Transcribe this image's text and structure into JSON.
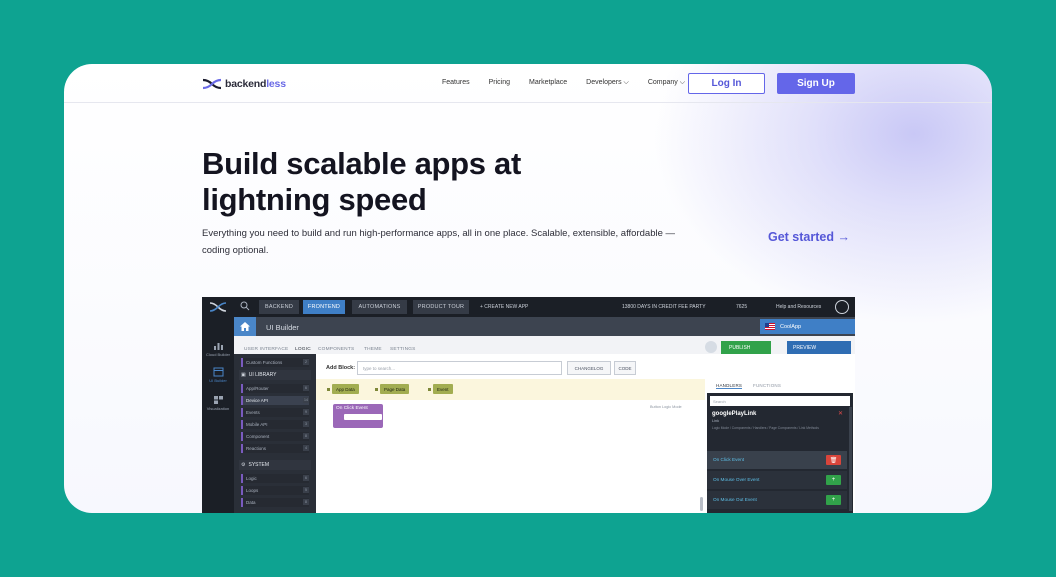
{
  "nav": {
    "logo_text_main": "backend",
    "logo_text_accent": "less",
    "links": [
      "Features",
      "Pricing",
      "Marketplace",
      "Developers ⌵",
      "Company ⌵"
    ],
    "login_label": "Log In",
    "signup_label": "Sign Up"
  },
  "hero": {
    "title": "Build scalable apps at lightning speed",
    "subtitle": "Everything you need to build and run high-performance apps, all in one place. Scalable, extensible, affordable — coding optional.",
    "cta_label": "Get started →"
  },
  "colors": {
    "background": "#0ea391",
    "brand": "#6466e9",
    "card": "#ffffff"
  },
  "app_preview": {
    "topbar_tabs": [
      "BACKEND",
      "FRONTEND",
      "AUTOMATIONS",
      "PRODUCT TOUR"
    ],
    "create_app": "+ CREATE NEW APP",
    "credit": "13800 DAYS IN CREDIT FEE PARTY",
    "points": "7625",
    "help": "Help and Resources",
    "rail": [
      "Cloud Builder",
      "UI Builder",
      "Visualization"
    ],
    "section_title": "UI Builder",
    "app_name": "CoolApp",
    "subtabs": [
      "USER INTERFACE",
      "LOGIC",
      "COMPONENTS",
      "THEME",
      "SETTINGS"
    ],
    "publish_label": "PUBLISH",
    "preview_label": "PREVIEW",
    "library": {
      "top_item": "Custom Functions",
      "group1": "UI LIBRARY",
      "items1": [
        {
          "label": "App/Router",
          "count": "6"
        },
        {
          "label": "Device API",
          "count": "14"
        },
        {
          "label": "Events",
          "count": "9"
        },
        {
          "label": "Mobile API",
          "count": "3"
        },
        {
          "label": "Component",
          "count": "8"
        },
        {
          "label": "Reactions",
          "count": "4"
        }
      ],
      "group2": "SYSTEM",
      "items2": [
        {
          "label": "Logic",
          "count": "6"
        },
        {
          "label": "Loops",
          "count": "5"
        },
        {
          "label": "Data",
          "count": "8"
        }
      ]
    },
    "addblock_label": "Add Block:",
    "addblock_placeholder": "type to search...",
    "changelog_label": "CHANGELOG",
    "code_label": "CODE",
    "chips": [
      "App Data",
      "Page Data",
      "Event"
    ],
    "hint": "Button Logic Mode",
    "event_block": "On Click Event",
    "right_tabs": [
      "HANDLERS",
      "FUNCTIONS"
    ],
    "right_search": "Search",
    "component_name": "googlePlayLink",
    "component_type": "Link",
    "component_desc": "Logic Mode / Components / Handlers / Page Components / Link Methods",
    "handlers": [
      {
        "label": "On Click Event",
        "action": "delete"
      },
      {
        "label": "On Mouse Over Event",
        "action": "add"
      },
      {
        "label": "On Mouse Out Event",
        "action": "add"
      }
    ]
  }
}
